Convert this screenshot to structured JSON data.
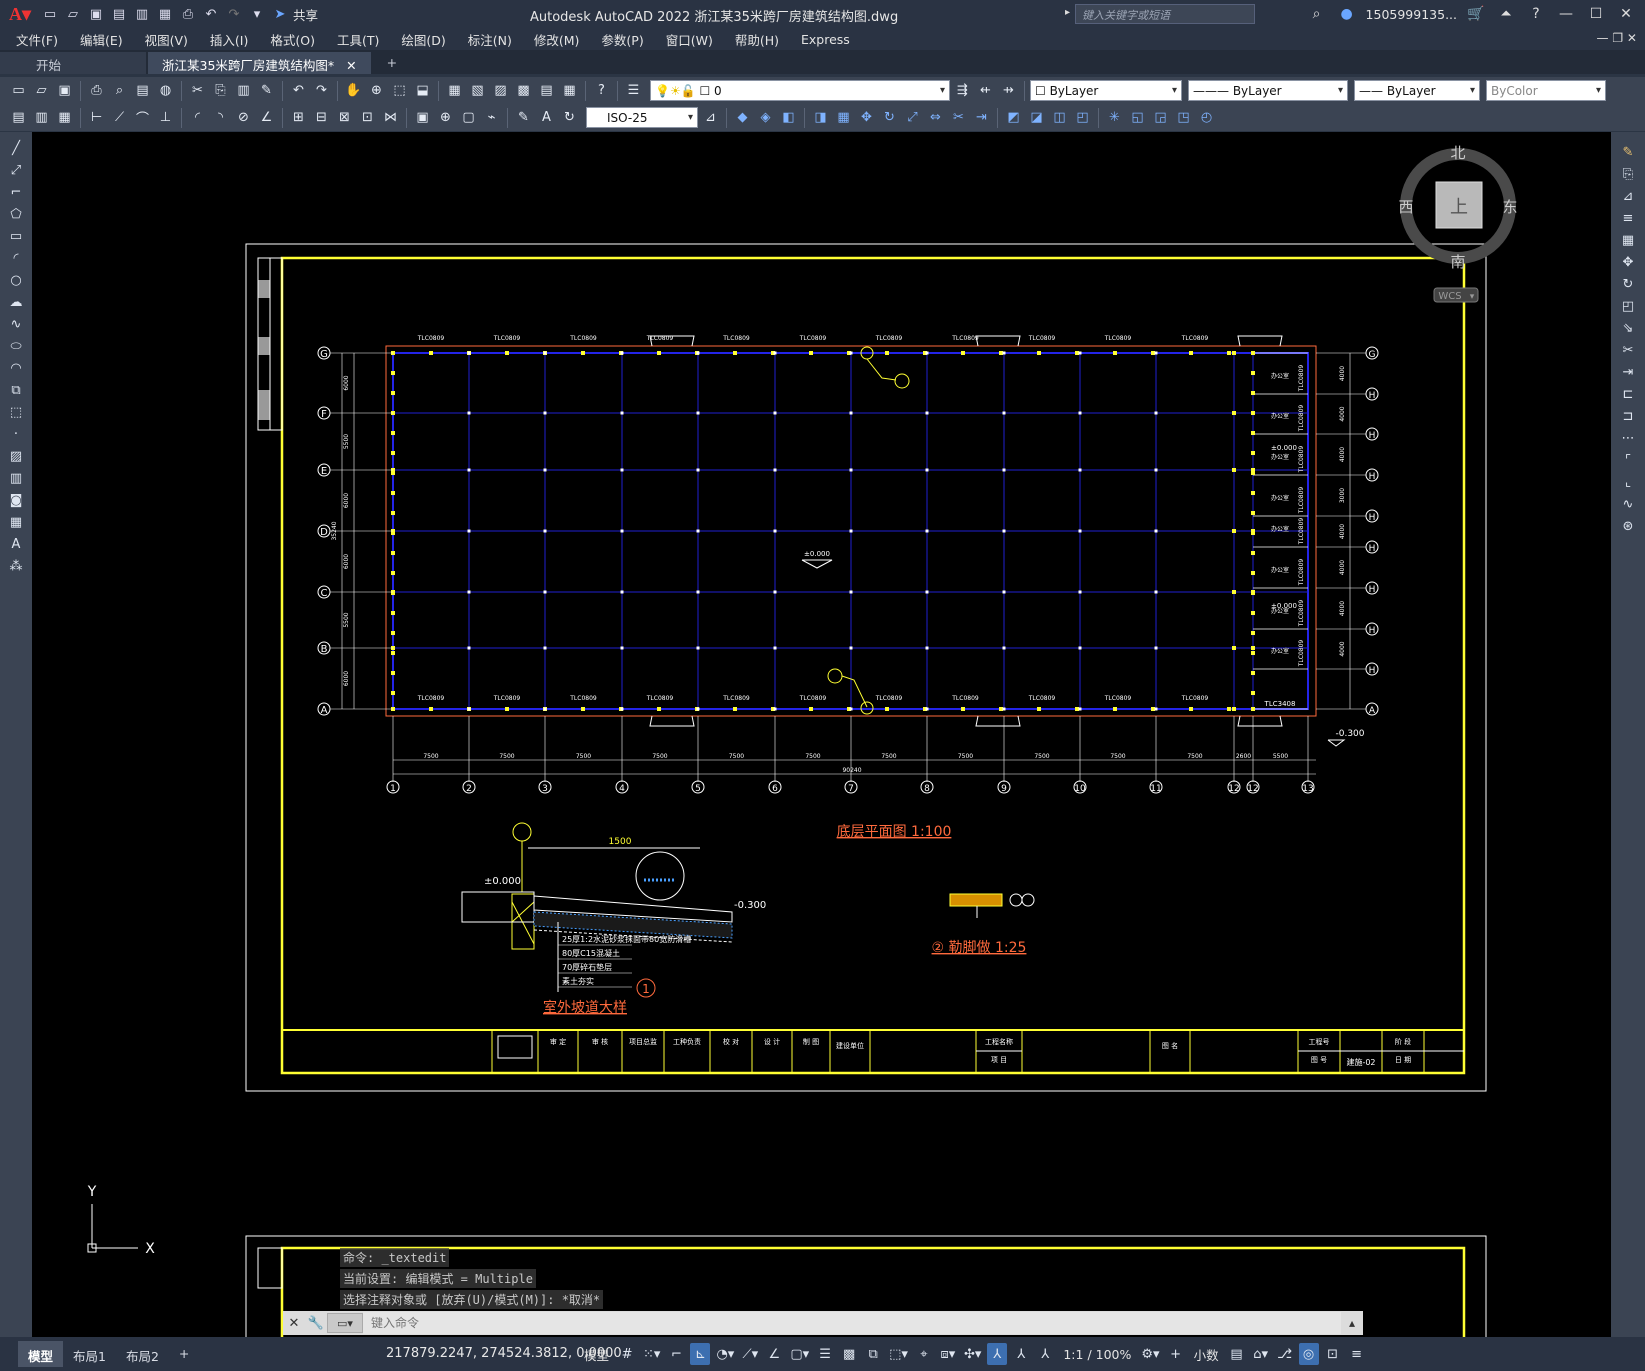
{
  "app": {
    "logo": "A",
    "title": "Autodesk AutoCAD 2022    浙江某35米跨厂房建筑结构图.dwg",
    "share_label": "共享",
    "search_placeholder": "键入关键字或短语",
    "user": "1505999135...",
    "help": "?"
  },
  "menu": [
    "文件(F)",
    "编辑(E)",
    "视图(V)",
    "插入(I)",
    "格式(O)",
    "工具(T)",
    "绘图(D)",
    "标注(N)",
    "修改(M)",
    "参数(P)",
    "窗口(W)",
    "帮助(H)",
    "Express"
  ],
  "tabs": [
    {
      "label": "开始"
    },
    {
      "label": "浙江某35米跨厂房建筑结构图*"
    }
  ],
  "toolbar": {
    "layer_value": "0",
    "color_value": "ByLayer",
    "linetype_value": "ByLayer",
    "lineweight_value": "ByLayer",
    "plotstyle_value": "ByColor",
    "dimstyle_value": "ISO-25"
  },
  "viewcube": {
    "north": "北",
    "south": "南",
    "east": "东",
    "west": "西",
    "top": "上",
    "wcs": "WCS"
  },
  "drawing": {
    "grid_rows": [
      "G",
      "F",
      "E",
      "D",
      "C",
      "B",
      "A"
    ],
    "grid_cols": [
      "1",
      "2",
      "3",
      "4",
      "5",
      "6",
      "7",
      "8",
      "9",
      "10",
      "11",
      "12",
      "12",
      "13"
    ],
    "right_rows": [
      "G",
      "H",
      "H",
      "H",
      "H",
      "H",
      "H",
      "H",
      "H",
      "A"
    ],
    "bay_dims": [
      "7500",
      "7500",
      "7500",
      "7500",
      "7500",
      "7500",
      "7500",
      "7500",
      "7500",
      "7500",
      "7500",
      "2600",
      "5500"
    ],
    "total_dim": "90240",
    "left_dims": [
      "6000",
      "5500",
      "6000",
      "6000",
      "5500",
      "6000"
    ],
    "left_total": "35240",
    "right_dims": [
      "4000",
      "4000",
      "4000",
      "3000",
      "4000",
      "4000",
      "4000",
      "4000"
    ],
    "elev_zero": "±0.000",
    "elev_outside": "-0.300",
    "plan_title": "底层平面图 1:100",
    "detail1_title": "室外坡道大样",
    "detail1_num": "1",
    "detail2_title": "② 勒脚做 1:25",
    "ramp_dim": "1500",
    "ramp_elev_left": "±0.000",
    "ramp_elev_right": "-0.300",
    "ramp_layers": [
      "25厚1:2水泥砂浆抹面带80宽防滑槽",
      "80厚C15混凝土",
      "70厚碎石垫层",
      "素土夯实"
    ],
    "window_tag": "TLC0809",
    "door_tag": "TLC3408",
    "room_tag": "办公室",
    "title_block": {
      "cells": [
        "审 定",
        "审 核",
        "项目总监",
        "工种负责",
        "校 对",
        "设 计",
        "制 图",
        "建设单位",
        "工程名称",
        "项 目",
        "图 名",
        "工程号",
        "图 号",
        "阶 段",
        "日 期"
      ],
      "drawing_no": "建施-02"
    }
  },
  "command": {
    "history": [
      "命令: _textedit",
      "当前设置: 编辑模式 = Multiple",
      "选择注释对象或 [放弃(U)/模式(M)]: *取消*"
    ],
    "placeholder": "键入命令"
  },
  "status": {
    "layout_tabs": [
      "模型",
      "布局1",
      "布局2"
    ],
    "coords": "217879.2247, 274524.3812, 0.0000",
    "model_label": "模型",
    "scale": "1:1 / 100%",
    "units": "小数"
  }
}
